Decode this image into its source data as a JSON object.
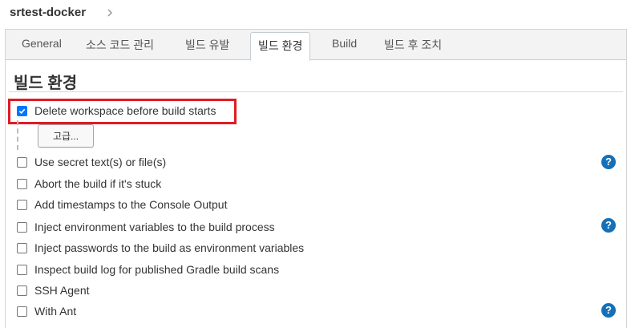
{
  "breadcrumb": {
    "job_name": "srtest-docker"
  },
  "tabs": [
    {
      "label": "General"
    },
    {
      "label": "소스 코드 관리"
    },
    {
      "label": "빌드 유발"
    },
    {
      "label": "빌드 환경"
    },
    {
      "label": "Build"
    },
    {
      "label": "빌드 후 조치"
    }
  ],
  "active_tab_index": 3,
  "section": {
    "title": "빌드 환경"
  },
  "advanced_button_label": "고급...",
  "options": [
    {
      "label": "Delete workspace before build starts",
      "checked": true,
      "help": false
    },
    {
      "label": "Use secret text(s) or file(s)",
      "checked": false,
      "help": true
    },
    {
      "label": "Abort the build if it's stuck",
      "checked": false,
      "help": false
    },
    {
      "label": "Add timestamps to the Console Output",
      "checked": false,
      "help": false
    },
    {
      "label": "Inject environment variables to the build process",
      "checked": false,
      "help": true
    },
    {
      "label": "Inject passwords to the build as environment variables",
      "checked": false,
      "help": false
    },
    {
      "label": "Inspect build log for published Gradle build scans",
      "checked": false,
      "help": false
    },
    {
      "label": "SSH Agent",
      "checked": false,
      "help": false
    },
    {
      "label": "With Ant",
      "checked": false,
      "help": true
    }
  ],
  "help_icon_glyph": "?",
  "colors": {
    "accent": "#0075ff",
    "highlight": "#e01b24",
    "help": "#1570b8"
  }
}
